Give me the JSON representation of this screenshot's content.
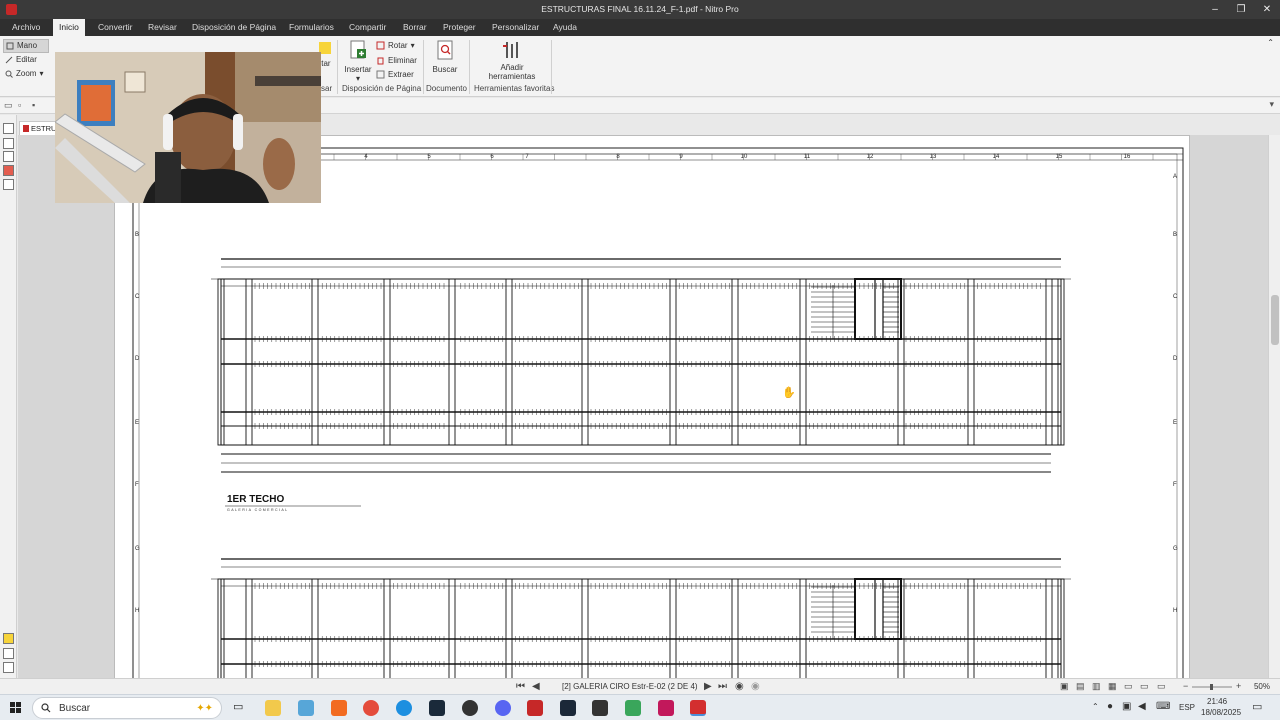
{
  "window": {
    "title": "ESTRUCTURAS FINAL 16.11.24_F-1.pdf - Nitro Pro",
    "minimize": "–",
    "restore": "❐",
    "close": "✕"
  },
  "menu": [
    "Archivo",
    "Inicio",
    "Convertir",
    "Revisar",
    "Disposición de Página",
    "Formularios",
    "Compartir",
    "Borrar",
    "Proteger",
    "Personalizar",
    "Ayuda"
  ],
  "menu_active": "Inicio",
  "left_tools": {
    "hand": "Mano",
    "edit": "Editar",
    "zoom": "Zoom"
  },
  "ribbon": {
    "partial_label": "ltar",
    "partial_group": "sar",
    "insert": "Insertar",
    "rotate": "Rotar",
    "delete": "Eliminar",
    "extract": "Extraer",
    "search": "Buscar",
    "add_tools_line1": "Añadir",
    "add_tools_line2": "herramientas",
    "group_page_layout": "Disposición de Página",
    "group_document": "Documento",
    "group_favorites": "Herramientas favoritas"
  },
  "doc_tab": "ESTRU",
  "drawing": {
    "column_numbers": [
      "4",
      "5",
      "6",
      "7",
      "8",
      "9",
      "10",
      "11",
      "12",
      "13",
      "14",
      "15",
      "16"
    ],
    "row_letters_left": [
      "B",
      "C",
      "D",
      "E",
      "F",
      "G",
      "H"
    ],
    "row_letters_right": [
      "A",
      "B",
      "C",
      "D",
      "E",
      "F",
      "G",
      "H"
    ],
    "plan_title": "1ER TECHO",
    "plan_subtitle": "GALERIA COMERCIAL"
  },
  "status": {
    "page_info": "[2] GALERIA CIRO Estr-E-02  (2 DE 4)",
    "zoom": "50%"
  },
  "taskbar": {
    "search_placeholder": "Buscar",
    "language": "ESP",
    "time": "21:46",
    "date": "18/08/2025"
  },
  "colors": {
    "titlebar": "#3a3a3a",
    "menubar": "#2f2f2f",
    "ribbon": "#f3f3f3",
    "accent_red": "#c62828"
  }
}
